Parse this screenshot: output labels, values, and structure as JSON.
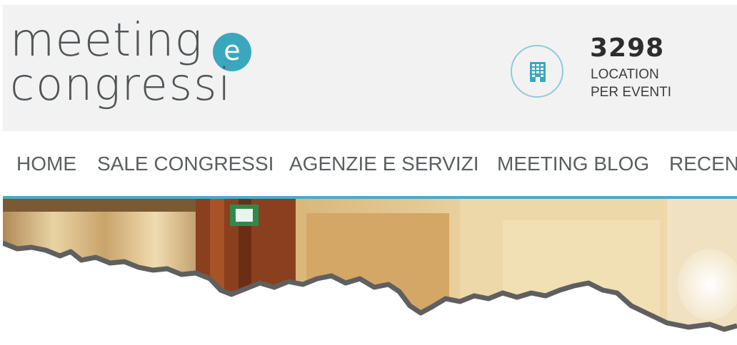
{
  "header": {
    "logo": {
      "line1": "meeting",
      "badge": "e",
      "line2": "congressi"
    },
    "stat": {
      "icon": "building-icon",
      "number": "3298",
      "label_line1": "LOCATION",
      "label_line2": "PER EVENTI"
    }
  },
  "nav": {
    "items": [
      {
        "label": "HOME"
      },
      {
        "label": "SALE CONGRESSI"
      },
      {
        "label": "AGENZIE E SERVIZI"
      },
      {
        "label": "MEETING BLOG"
      },
      {
        "label": "RECEN"
      }
    ]
  },
  "colors": {
    "accent": "#3aa7bd",
    "nav_border": "#4ea9c6",
    "header_bg": "#f2f2f2",
    "nav_text": "#5a5e62"
  }
}
